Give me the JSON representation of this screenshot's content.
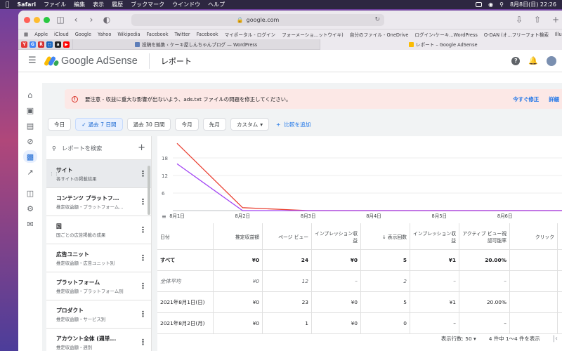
{
  "menubar": {
    "app": "Safari",
    "items": [
      "ファイル",
      "編集",
      "表示",
      "履歴",
      "ブックマーク",
      "ウインドウ",
      "ヘルプ"
    ],
    "clock": "8月8日(日)  22:26"
  },
  "browser": {
    "url": "google.com",
    "favorites": [
      "Apple",
      "iCloud",
      "Google",
      "Yahoo",
      "Wikipedia",
      "Facebook",
      "Twitter",
      "Facebook",
      "マイポータル - ログイン",
      "フォーメーショ...ットウイキ)",
      "自分のファイル - OneDrive",
      "ログイン‹ケーキ...WordPress",
      "O-DAN (オ...フリーフォト検索",
      "Illustrations | unDraw"
    ],
    "tabs": [
      "投稿を編集 ‹ ケーキ屋しんちゃんブログ — WordPress",
      "レポート – Google AdSense"
    ]
  },
  "header": {
    "brand": "Google AdSense",
    "title": "レポート"
  },
  "alert": {
    "text": "要注意 - 収益に重大な影響が出ないよう、ads.txt ファイルの問題を修正してください。",
    "fix_now": "今すぐ修正",
    "details": "詳細"
  },
  "filters": {
    "chips": [
      "今日",
      "過去 7 日間",
      "過去 30 日間",
      "今月",
      "先月",
      "カスタム"
    ],
    "selected_index": 1,
    "add_compare": "比較を追加"
  },
  "panel": {
    "search_placeholder": "レポートを検索",
    "reports": [
      {
        "title": "サイト",
        "subtitle": "各サイトの掲載結果"
      },
      {
        "title": "コンテンツ プラットフ...",
        "subtitle": "推定収益額・プラットフォーム..."
      },
      {
        "title": "国",
        "subtitle": "国ごとの広告掲載の成果"
      },
      {
        "title": "広告ユニット",
        "subtitle": "推定収益額・広告ユニット別"
      },
      {
        "title": "プラットフォーム",
        "subtitle": "推定収益額・プラットフォーム別"
      },
      {
        "title": "プロダクト",
        "subtitle": "推定収益額・サービス別"
      },
      {
        "title": "アカウント全体 (週単...",
        "subtitle": "推定収益額・週別"
      }
    ]
  },
  "chart_data": {
    "type": "line",
    "categories": [
      "8月1日",
      "8月2日",
      "8月3日",
      "8月4日",
      "8月5日",
      "8月6日",
      "8月7日"
    ],
    "yticks": [
      6,
      12,
      18
    ],
    "ylim": [
      0,
      24
    ],
    "series": [
      {
        "values": [
          23,
          1,
          0,
          0,
          0,
          0,
          0
        ],
        "color": "#ea4335"
      },
      {
        "values": [
          16,
          0,
          0,
          0,
          0,
          0,
          0
        ],
        "color": "#a142f4"
      }
    ],
    "grid": true
  },
  "table": {
    "headers": [
      "日付",
      "推定収益額",
      "ページ ビュー",
      "インプレッション収益",
      "↓ 表示回数",
      "インプレッション収益",
      "アクティブ ビュー視認可能率",
      "クリック"
    ],
    "rows": [
      {
        "style": "bold",
        "cells": [
          "すべて",
          "¥0",
          "24",
          "¥0",
          "5",
          "¥1",
          "20.00%",
          ""
        ]
      },
      {
        "style": "italic",
        "cells": [
          "全体平均",
          "¥0",
          "12",
          "–",
          "2",
          "–",
          "–",
          ""
        ]
      },
      {
        "style": "normal",
        "cells": [
          "2021年8月1日(日)",
          "¥0",
          "23",
          "¥0",
          "5",
          "¥1",
          "20.00%",
          ""
        ]
      },
      {
        "style": "normal",
        "cells": [
          "2021年8月2日(月)",
          "¥0",
          "1",
          "¥0",
          "0",
          "–",
          "–",
          ""
        ]
      }
    ]
  },
  "pager": {
    "rows_label": "表示行数:",
    "rows_value": "50",
    "range": "4 件中 1〜4 件を表示"
  }
}
